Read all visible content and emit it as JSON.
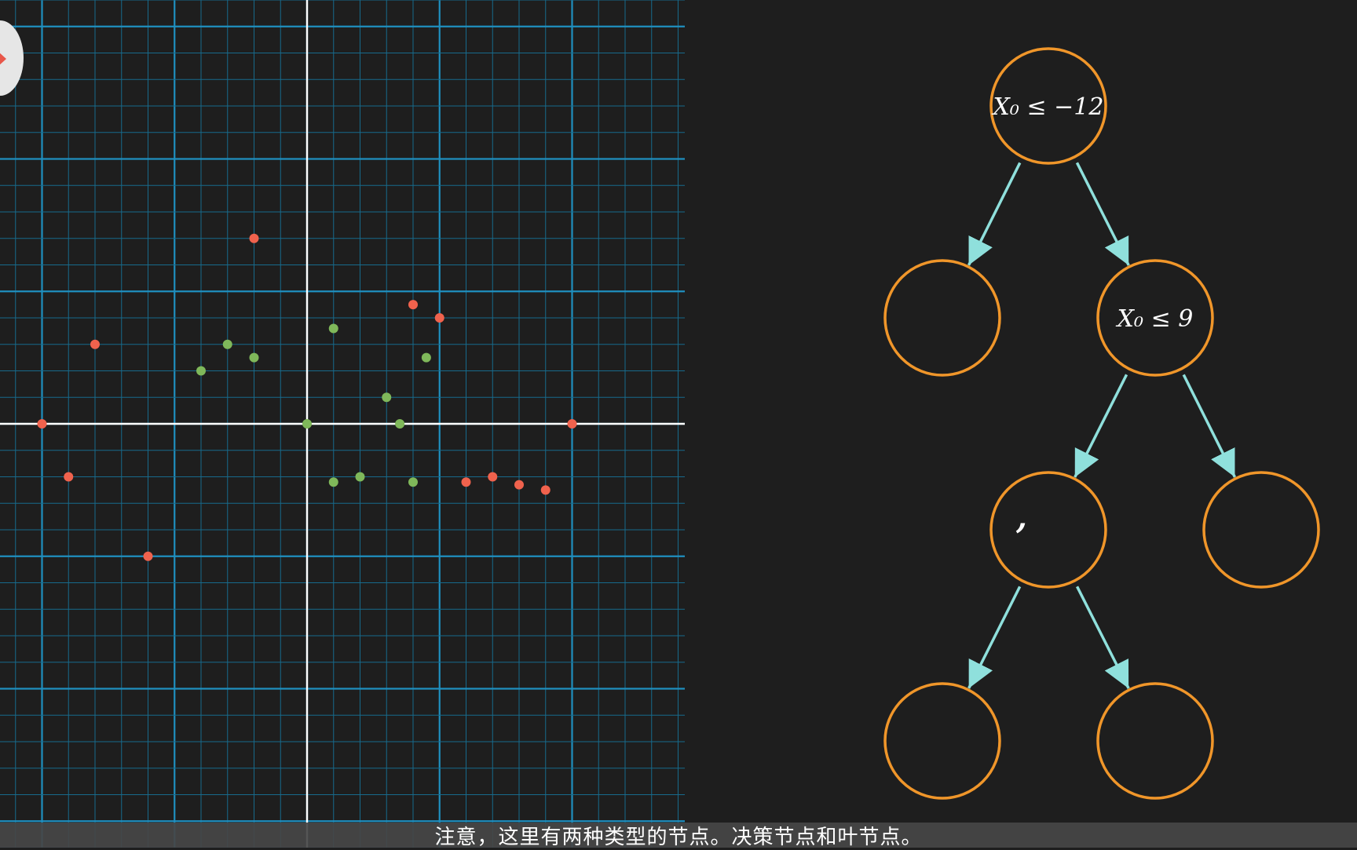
{
  "colors": {
    "background": "#1e1e1e",
    "grid_major": "#1f8fbf",
    "grid_minor": "#176a8c",
    "axis": "#ffffff",
    "class_red": "#f0624d",
    "class_green": "#7fb85a",
    "node_stroke": "#f0962a",
    "edge": "#8fe0dc"
  },
  "scatter": {
    "red_points": [
      [
        -10,
        0
      ],
      [
        -8,
        3
      ],
      [
        -9,
        -2
      ],
      [
        -6,
        -5
      ],
      [
        -2,
        7
      ],
      [
        4,
        4.5
      ],
      [
        5,
        4
      ],
      [
        6,
        -2.2
      ],
      [
        7,
        -2
      ],
      [
        8,
        -2.3
      ],
      [
        9,
        -2.5
      ],
      [
        10,
        0
      ]
    ],
    "green_points": [
      [
        -3,
        3
      ],
      [
        -2,
        2.5
      ],
      [
        -4,
        2
      ],
      [
        0,
        0
      ],
      [
        1,
        3.6
      ],
      [
        2,
        -2
      ],
      [
        1,
        -2.2
      ],
      [
        3,
        1
      ],
      [
        3.5,
        0
      ],
      [
        4.5,
        2.5
      ],
      [
        4,
        -2.2
      ]
    ]
  },
  "tree": {
    "nodes": [
      {
        "id": "root",
        "label": "X₀ ≤ −12"
      },
      {
        "id": "left",
        "label": ""
      },
      {
        "id": "right",
        "label": "X₀ ≤ 9"
      },
      {
        "id": "right-left",
        "label": ","
      },
      {
        "id": "right-right",
        "label": ""
      },
      {
        "id": "rl-left",
        "label": ""
      },
      {
        "id": "rl-right",
        "label": ""
      }
    ],
    "edges": [
      [
        "root",
        "left"
      ],
      [
        "root",
        "right"
      ],
      [
        "right",
        "right-left"
      ],
      [
        "right",
        "right-right"
      ],
      [
        "right-left",
        "rl-left"
      ],
      [
        "right-left",
        "rl-right"
      ]
    ]
  },
  "subtitle": "注意，这里有两种类型的节点。决策节点和叶节点。"
}
